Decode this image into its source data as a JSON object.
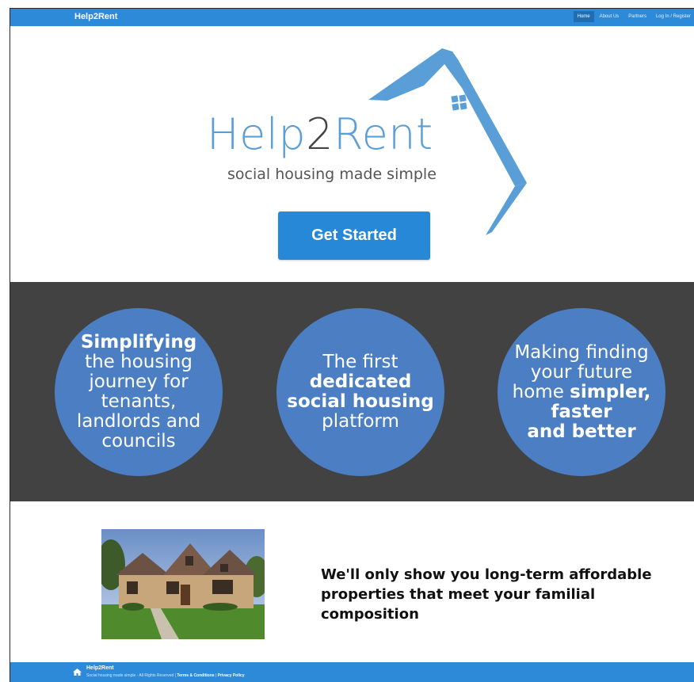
{
  "navbar": {
    "brand": "Help2Rent",
    "items": [
      {
        "label": "Home",
        "active": true
      },
      {
        "label": "About Us",
        "active": false
      },
      {
        "label": "Partners",
        "active": false
      },
      {
        "label": "Log In / Register",
        "active": false
      }
    ]
  },
  "hero": {
    "logo_part1": "Help",
    "logo_part2": "2",
    "logo_part3": "Rent",
    "tagline": "social housing made simple",
    "cta_label": "Get Started"
  },
  "features": {
    "circle1": {
      "bold": "Simplifying",
      "lines": [
        "the housing",
        "journey for",
        "tenants,",
        "landlords and",
        "councils"
      ]
    },
    "circle2": {
      "line1": "The first",
      "bold1": "dedicated",
      "bold2": "social housing",
      "line2": "platform"
    },
    "circle3": {
      "line1": "Making finding",
      "line2": "your future",
      "line3_start": "home ",
      "bold1": "simpler,",
      "bold2": "faster",
      "bold3": "and better"
    }
  },
  "promo": {
    "line1": "We'll only show you long-term affordable",
    "line2": "properties that meet your familial composition"
  },
  "footer": {
    "brand": "Help2Rent",
    "copyright": "Social housing made simple - All Rights Reserved | ",
    "terms": "Terms & Conditions",
    "separator": " | ",
    "privacy": "Privacy Policy"
  },
  "colors": {
    "primary": "#2d8ad8",
    "dark_band": "#424242",
    "circle": "#4b7ec3"
  }
}
